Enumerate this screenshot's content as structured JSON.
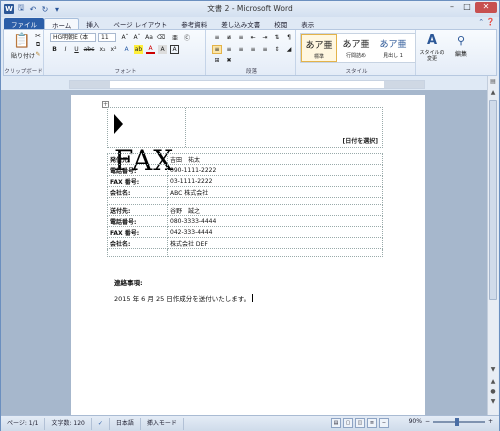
{
  "window": {
    "title": "文書 2 - Microsoft Word"
  },
  "qat": {
    "icons": [
      "word-logo",
      "save-icon",
      "undo-icon",
      "redo-icon",
      "customize-icon"
    ],
    "word_logo": "W"
  },
  "tabs": [
    {
      "label": "ファイル"
    },
    {
      "label": "ホーム"
    },
    {
      "label": "挿入"
    },
    {
      "label": "ページ レイアウト"
    },
    {
      "label": "参考資料"
    },
    {
      "label": "差し込み文書"
    },
    {
      "label": "校閲"
    },
    {
      "label": "表示"
    }
  ],
  "ribbon": {
    "clipboard": {
      "paste_label": "貼り付け",
      "group_label": "クリップボード"
    },
    "font": {
      "font_name": "HG明朝E (本",
      "font_size": "11",
      "group_label": "フォント"
    },
    "paragraph": {
      "group_label": "段落"
    },
    "styles": {
      "items": [
        {
          "preview": "あア亜",
          "name": "標準"
        },
        {
          "preview": "あア亜",
          "name": "行間詰め"
        },
        {
          "preview": "あア亜",
          "name": "見出し 1"
        }
      ],
      "change_label": "スタイルの変更",
      "group_label": "スタイル"
    },
    "editing": {
      "label": "編集"
    }
  },
  "document": {
    "fax_title": "FAX",
    "date_placeholder": "[日付を選択]",
    "sender_rows": [
      {
        "label": "発信元:",
        "value": "吉田　祐太"
      },
      {
        "label": "電話番号:",
        "value": "090-1111-2222"
      },
      {
        "label": "FAX 番号:",
        "value": "03-1111-2222"
      },
      {
        "label": "会社名:",
        "value": "ABC 株式会社"
      }
    ],
    "recipient_rows": [
      {
        "label": "送付先:",
        "value": "谷野　誠之"
      },
      {
        "label": "電話番号:",
        "value": "080-3333-4444"
      },
      {
        "label": "FAX 番号:",
        "value": "042-333-4444"
      },
      {
        "label": "会社名:",
        "value": "株式会社 DEF"
      }
    ],
    "memo_heading": "連絡事項:",
    "memo_body": "2015 年 6 月 25 日作成分を送付いたします。"
  },
  "status": {
    "page": "ページ: 1/1",
    "words": "文字数: 120",
    "language": "日本語",
    "mode": "挿入モード",
    "zoom": "90%",
    "zoom_level": 0.45
  }
}
